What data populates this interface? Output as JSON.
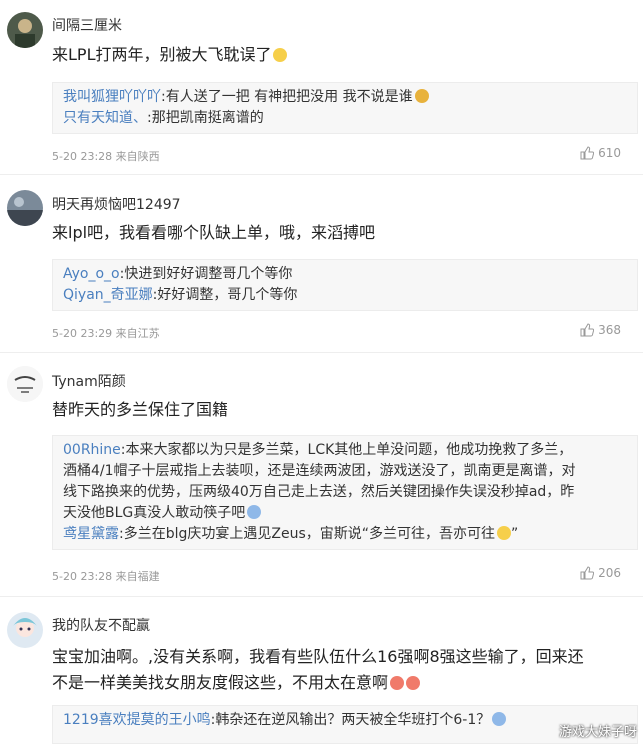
{
  "comments": [
    {
      "username": "间隔三厘米",
      "content": "来LPL打两年，别被大飞耽误了",
      "replies": [
        {
          "name": "我叫狐狸吖吖吖",
          "text": ":有人送了一把 有神把把没用 我不说是谁"
        },
        {
          "name": "只有天知道、",
          "text": ":那把凯南挺离谱的"
        }
      ],
      "meta": "5-20 23:28 来自陕西",
      "likes": "610"
    },
    {
      "username": "明天再烦恼吧12497",
      "content": "来lpl吧，我看看哪个队缺上单，哦，来滔搏吧",
      "replies": [
        {
          "name": "Ayo_o_o",
          "text": ":快进到好好调整哥几个等你"
        },
        {
          "name": "Qiyan_奇亚娜",
          "text": ":好好调整，哥几个等你"
        }
      ],
      "meta": "5-20 23:29 来自江苏",
      "likes": "368"
    },
    {
      "username": "Tynam陌颜",
      "content": "替昨天的多兰保住了国籍",
      "replies": [
        {
          "name": "00Rhine",
          "lines": [
            ":本来大家都以为只是多兰菜，LCK其他上单没问题，他成功挽救了多兰，",
            "酒桶4/1帽子十层戒指上去装呗，还是连续两波团，游戏送没了，凯南更是离谱，对",
            "线下路换来的优势，压两级40万自己走上去送，然后关键团操作失误没秒掉ad，昨",
            "天没他BLG真没人敢动筷子吧"
          ]
        },
        {
          "name": "鸢星黛露",
          "text": ":多兰在blg庆功宴上遇见Zeus，宙斯说“多兰可往，吾亦可往",
          "tail": "”"
        }
      ],
      "meta": "5-20 23:28 来自福建",
      "likes": "206"
    },
    {
      "username": "我的队友不配赢",
      "content_lines": [
        "宝宝加油啊。,没有关系啊，我看有些队伍什么16强啊8强这些输了，回来还",
        "不是一样美美找女朋友度假这些，不用太在意啊"
      ],
      "replies": [
        {
          "name": "1219喜欢提莫的王小鸣",
          "text": ":韩杂还在逆风输出？两天被全华班打个6-1？"
        }
      ]
    }
  ],
  "watermark": "游戏大妹子呀",
  "colors": {
    "link": "#4a7fbf",
    "meta": "#999999",
    "reply_bg": "#f7f7f7"
  }
}
